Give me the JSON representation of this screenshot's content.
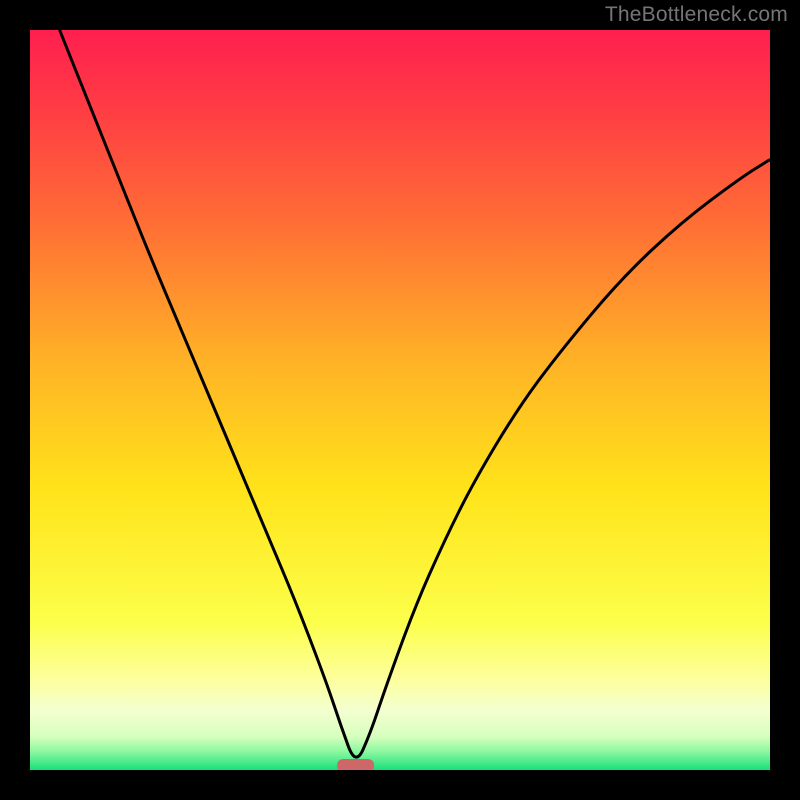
{
  "watermark": "TheBottleneck.com",
  "colors": {
    "frame": "#000000",
    "watermark": "#757575",
    "curve": "#000000",
    "marker": "#ce6868",
    "gradient_stops": [
      {
        "offset": 0.0,
        "color": "#ff1f4f"
      },
      {
        "offset": 0.1,
        "color": "#ff3a45"
      },
      {
        "offset": 0.25,
        "color": "#ff6a36"
      },
      {
        "offset": 0.45,
        "color": "#ffb326"
      },
      {
        "offset": 0.62,
        "color": "#ffe31a"
      },
      {
        "offset": 0.8,
        "color": "#fcff4a"
      },
      {
        "offset": 0.88,
        "color": "#fdffa0"
      },
      {
        "offset": 0.92,
        "color": "#f3ffd0"
      },
      {
        "offset": 0.955,
        "color": "#d6ffbe"
      },
      {
        "offset": 0.975,
        "color": "#8cf8a0"
      },
      {
        "offset": 1.0,
        "color": "#18e07a"
      }
    ]
  },
  "chart_data": {
    "type": "line",
    "title": "",
    "xlabel": "",
    "ylabel": "",
    "xlim": [
      0,
      100
    ],
    "ylim": [
      0,
      100
    ],
    "minimum_at_x": 44,
    "marker": {
      "x": 44,
      "y": 0,
      "width_pct": 5
    },
    "series": [
      {
        "name": "curve",
        "x": [
          4,
          8,
          12,
          16,
          20,
          24,
          28,
          32,
          36,
          40,
          42,
          44,
          46,
          48,
          52,
          56,
          60,
          66,
          72,
          80,
          88,
          96,
          100
        ],
        "y": [
          100,
          90,
          80,
          70,
          60.5,
          51,
          41.5,
          32,
          22.5,
          12,
          6,
          0.5,
          5,
          11,
          22,
          31,
          39,
          49,
          57,
          66.5,
          74,
          80,
          82.5
        ]
      }
    ]
  }
}
